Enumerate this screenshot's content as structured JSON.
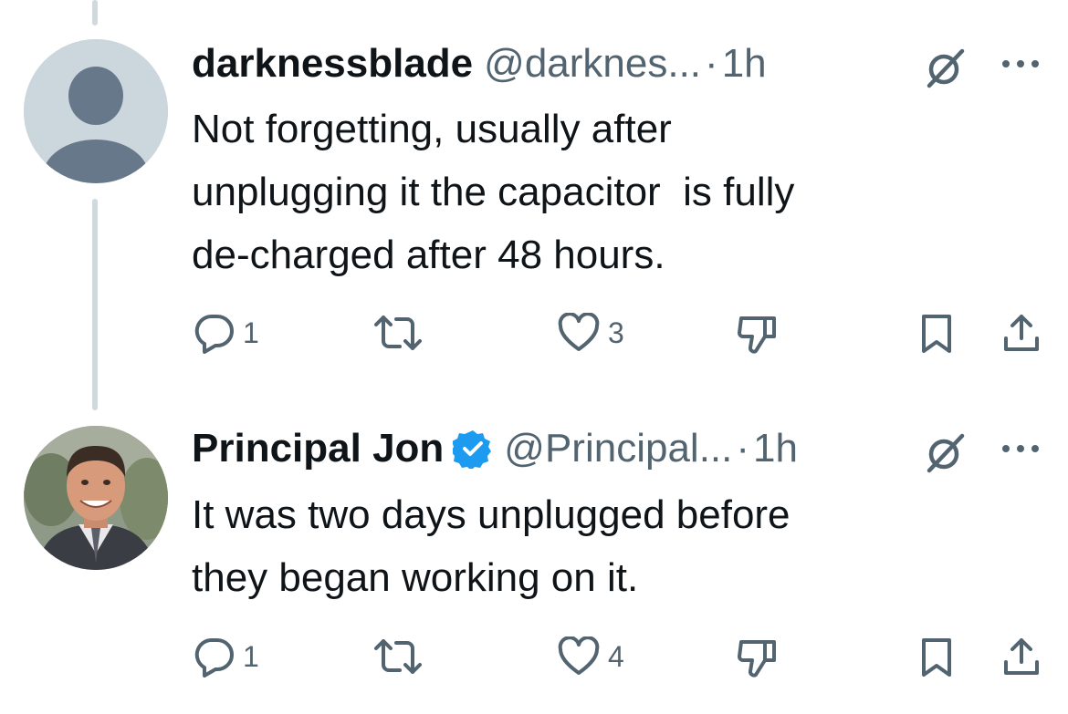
{
  "tweets": [
    {
      "display_name": "darknessblade",
      "verified": false,
      "handle": "@darknes...",
      "separator": "·",
      "time": "1h",
      "text": "Not forgetting, usually after\nunplugging it the capacitor  is fully\nde-charged after 48 hours.",
      "avatar": "default-avatar",
      "actions": {
        "replies": "1",
        "retweets": "",
        "likes": "3"
      }
    },
    {
      "display_name": "Principal Jon",
      "verified": true,
      "handle": "@Principal...",
      "separator": "·",
      "time": "1h",
      "text": "It was two days unplugged before\nthey began working on it.",
      "avatar": "profile-photo",
      "actions": {
        "replies": "1",
        "retweets": "",
        "likes": "4"
      }
    }
  ],
  "colors": {
    "text": "#0f1419",
    "secondary": "#536471",
    "verified": "#1d9bf0",
    "thread_line": "#cfd9de",
    "default_avatar_bg": "#ccd6dd",
    "default_avatar_fg": "#66788a"
  },
  "icons": [
    "reply-icon",
    "retweet-icon",
    "like-icon",
    "dislike-icon",
    "bookmark-icon",
    "share-icon",
    "grok-icon",
    "more-icon",
    "verified-icon"
  ]
}
